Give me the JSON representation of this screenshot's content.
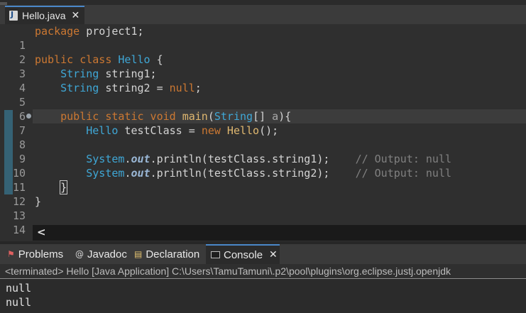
{
  "editor": {
    "tab_label": "Hello.java",
    "file_icon_glyph": "J",
    "close_glyph": "✕",
    "lines": [
      {
        "n": "1"
      },
      {
        "n": "2"
      },
      {
        "n": "3"
      },
      {
        "n": "4"
      },
      {
        "n": "5"
      },
      {
        "n": "6"
      },
      {
        "n": "7"
      },
      {
        "n": "8"
      },
      {
        "n": "9"
      },
      {
        "n": "10"
      },
      {
        "n": "11"
      },
      {
        "n": "12"
      },
      {
        "n": "13"
      },
      {
        "n": "14"
      }
    ],
    "tokens": {
      "l1_kw": "package",
      "l1_rest": " project1;",
      "l3_kw": "public class",
      "l3_cls": "Hello",
      "l3_rest": " {",
      "l4_type": "String",
      "l4_field": " string1;",
      "l5_type": "String",
      "l5_field": " string2 = ",
      "l5_null": "null",
      "l5_semi": ";",
      "l7_kw": "public static void",
      "l7_method": "main",
      "l7_paren": "(",
      "l7_type": "String",
      "l7_rest": "[] ",
      "l7_param": "a",
      "l7_end": "){",
      "l8_cls": "Hello",
      "l8_var": " testClass = ",
      "l8_new": "new",
      "l8_ctor": " Hello",
      "l8_end": "();",
      "l10_sys": "System",
      "l10_dot": ".",
      "l10_out": "out",
      "l10_call": ".println(testClass.string1);",
      "l10_cmt": "// Output: null",
      "l11_sys": "System",
      "l11_dot": ".",
      "l11_out": "out",
      "l11_call": ".println(testClass.string2);",
      "l11_cmt": "// Output: null",
      "l12_brace": "}",
      "l13_brace": "}"
    },
    "scroll_left_glyph": "<"
  },
  "panel": {
    "tabs": [
      {
        "label": "Problems",
        "icon": "problems-icon"
      },
      {
        "label": "Javadoc",
        "icon": "javadoc-icon"
      },
      {
        "label": "Declaration",
        "icon": "declaration-icon"
      },
      {
        "label": "Console",
        "icon": "console-icon",
        "active": true
      }
    ],
    "close_glyph": "✕",
    "console_status": "<terminated> Hello [Java Application] C:\\Users\\TamuTamuni\\.p2\\pool\\plugins\\org.eclipse.justj.openjdk",
    "output": [
      "null",
      "null"
    ]
  },
  "colors": {
    "keyword": "#cc7832",
    "type": "#3fa7d6",
    "comment": "#808080",
    "accent": "#4a87c8"
  }
}
